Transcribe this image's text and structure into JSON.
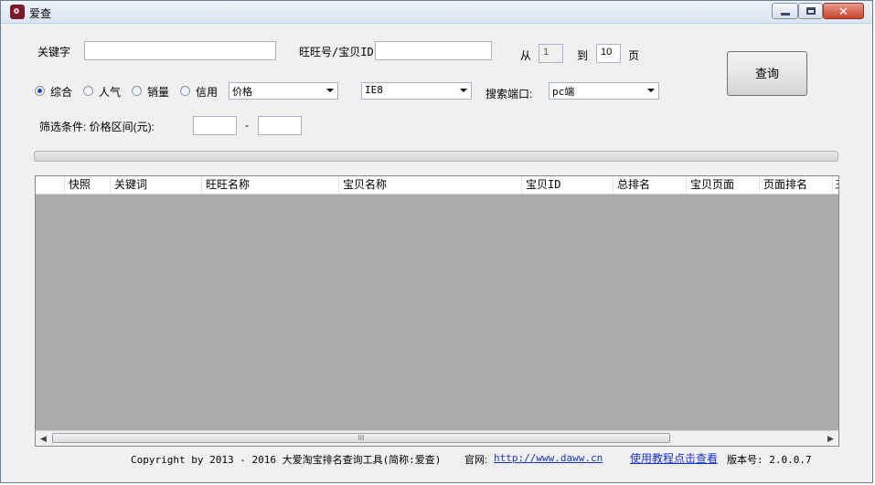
{
  "window": {
    "title": "爱查"
  },
  "titlebar": {
    "close_glyph": "✕"
  },
  "search": {
    "keyword_label": "关键字",
    "keyword_value": "",
    "wangwang_label": "旺旺号/宝贝ID",
    "wangwang_value": "",
    "from_label": "从",
    "from_value": "1",
    "to_label": "到",
    "to_value": "10",
    "page_label": "页",
    "query_button": "查询"
  },
  "sort": {
    "options": [
      "综合",
      "人气",
      "销量",
      "信用"
    ],
    "selected": "综合",
    "price_select": "价格",
    "browser_select": "IE8",
    "port_label": "搜索端口:",
    "port_select": "pc端"
  },
  "filter": {
    "label": "筛选条件: 价格区间(元):",
    "min_value": "",
    "dash": "-",
    "max_value": ""
  },
  "progress": {
    "value": 0
  },
  "table": {
    "columns": [
      "",
      "快照",
      "关键词",
      "旺旺名称",
      "宝贝名称",
      "宝贝ID",
      "总排名",
      "宝贝页面",
      "页面排名",
      "三"
    ],
    "rows": [],
    "scroll_thumb_glyph": "III",
    "scroll_left_glyph": "◀",
    "scroll_right_glyph": "▶"
  },
  "footer": {
    "copyright": "Copyright by 2013 - 2016 大爱淘宝排名查询工具(简称:爱查)",
    "site_label": "官网:",
    "site_url": "http://www.daww.cn",
    "tutorial_link": "使用教程点击查看",
    "version": "版本号: 2.0.0.7"
  },
  "colors": {
    "accent": "#1c4f9c",
    "link": "#1a33c8",
    "grid_bg": "#ababab"
  }
}
